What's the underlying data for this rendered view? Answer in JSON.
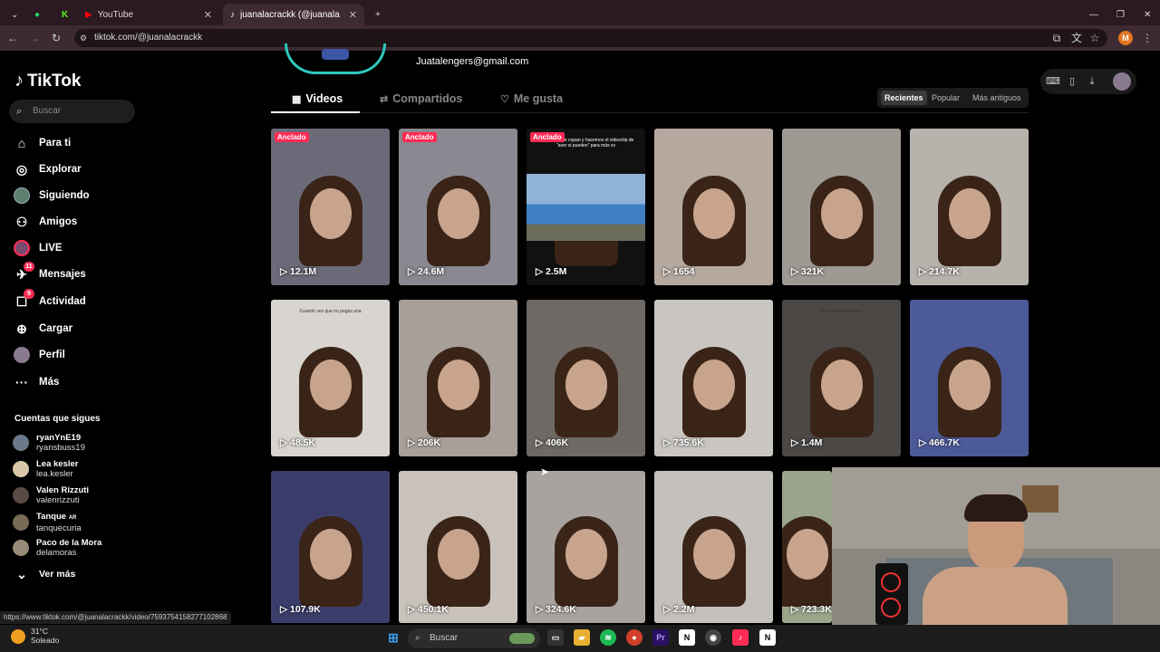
{
  "browser": {
    "tabs": [
      {
        "label": "YouTube",
        "icon": "youtube-icon"
      },
      {
        "label": "juanalacrackk (@juanalacrackk",
        "icon": "tiktok-icon"
      }
    ],
    "url": "tiktok.com/@juanalacrackk",
    "profile_initial": "M"
  },
  "sidebar": {
    "logo": "TikTok",
    "search_placeholder": "Buscar",
    "nav": [
      {
        "label": "Para ti",
        "icon": "home-icon"
      },
      {
        "label": "Explorar",
        "icon": "compass-icon"
      },
      {
        "label": "Siguiendo",
        "icon": "following-avatar-icon"
      },
      {
        "label": "Amigos",
        "icon": "friends-icon"
      },
      {
        "label": "LIVE",
        "icon": "live-icon"
      },
      {
        "label": "Mensajes",
        "icon": "messages-icon",
        "badge": "11"
      },
      {
        "label": "Actividad",
        "icon": "activity-icon",
        "badge": "9"
      },
      {
        "label": "Cargar",
        "icon": "upload-icon"
      },
      {
        "label": "Perfil",
        "icon": "profile-avatar-icon"
      },
      {
        "label": "Más",
        "icon": "more-icon"
      }
    ],
    "following_title": "Cuentas que sigues",
    "following": [
      {
        "name": "ryanYnE19",
        "handle": "ryansbuss19"
      },
      {
        "name": "Lea kesler",
        "handle": "lea.kesler"
      },
      {
        "name": "Valen Rizzuti",
        "handle": "valenrizzuti"
      },
      {
        "name": "Tanque",
        "name_tag": "AR",
        "handle": "tanquecuria"
      },
      {
        "name": "Paco de la Mora",
        "handle": "delamoras"
      }
    ],
    "see_more": "Ver más"
  },
  "profile": {
    "email": "Juatalengers@gmail.com",
    "tabs": [
      {
        "label": "Videos",
        "icon": "grid-icon"
      },
      {
        "label": "Compartidos",
        "icon": "repost-icon"
      },
      {
        "label": "Me gusta",
        "icon": "heart-icon"
      }
    ],
    "sort": [
      "Recientes",
      "Popular",
      "Más antiguos"
    ]
  },
  "videos": [
    {
      "views": "12.1M",
      "pinned": "Anclado",
      "bg": "#6b6a78"
    },
    {
      "views": "24.6M",
      "pinned": "Anclado",
      "bg": "#8a8890"
    },
    {
      "views": "2.5M",
      "pinned": "Anclado",
      "bg": "#111",
      "caption": "Mis amigos se copan y hacemos el videoclip de \"aver si pueden\" para más xv"
    },
    {
      "views": "1654",
      "bg": "#b5a89e"
    },
    {
      "views": "321K",
      "bg": "#9e9a93"
    },
    {
      "views": "214.7K",
      "bg": "#b8b2ac"
    },
    {
      "views": "48.5K",
      "bg": "#d8d4cf",
      "caption": "Cuando ves que no pegás una"
    },
    {
      "views": "206K",
      "bg": "#a79f98"
    },
    {
      "views": "406K",
      "bg": "#6e6965"
    },
    {
      "views": "735.6K",
      "bg": "#c9c6c2"
    },
    {
      "views": "1.4M",
      "bg": "#4b4846",
      "caption": "Pov: poten un temon"
    },
    {
      "views": "466.7K",
      "bg": "#4d5a9a"
    },
    {
      "views": "107.9K",
      "bg": "#3b3e6a"
    },
    {
      "views": "450.1K",
      "bg": "#c9c2bb"
    },
    {
      "views": "324.6K",
      "bg": "#a8a39e"
    },
    {
      "views": "2.2M",
      "bg": "#c4c0bb"
    },
    {
      "views": "723.3K",
      "bg": "#9aa58c"
    }
  ],
  "status_url": "https://www.tiktok.com/@juanalacrackk/video/7593754158277102868",
  "taskbar": {
    "temperature": "31°C",
    "weather": "Soleado",
    "search": "Buscar"
  }
}
